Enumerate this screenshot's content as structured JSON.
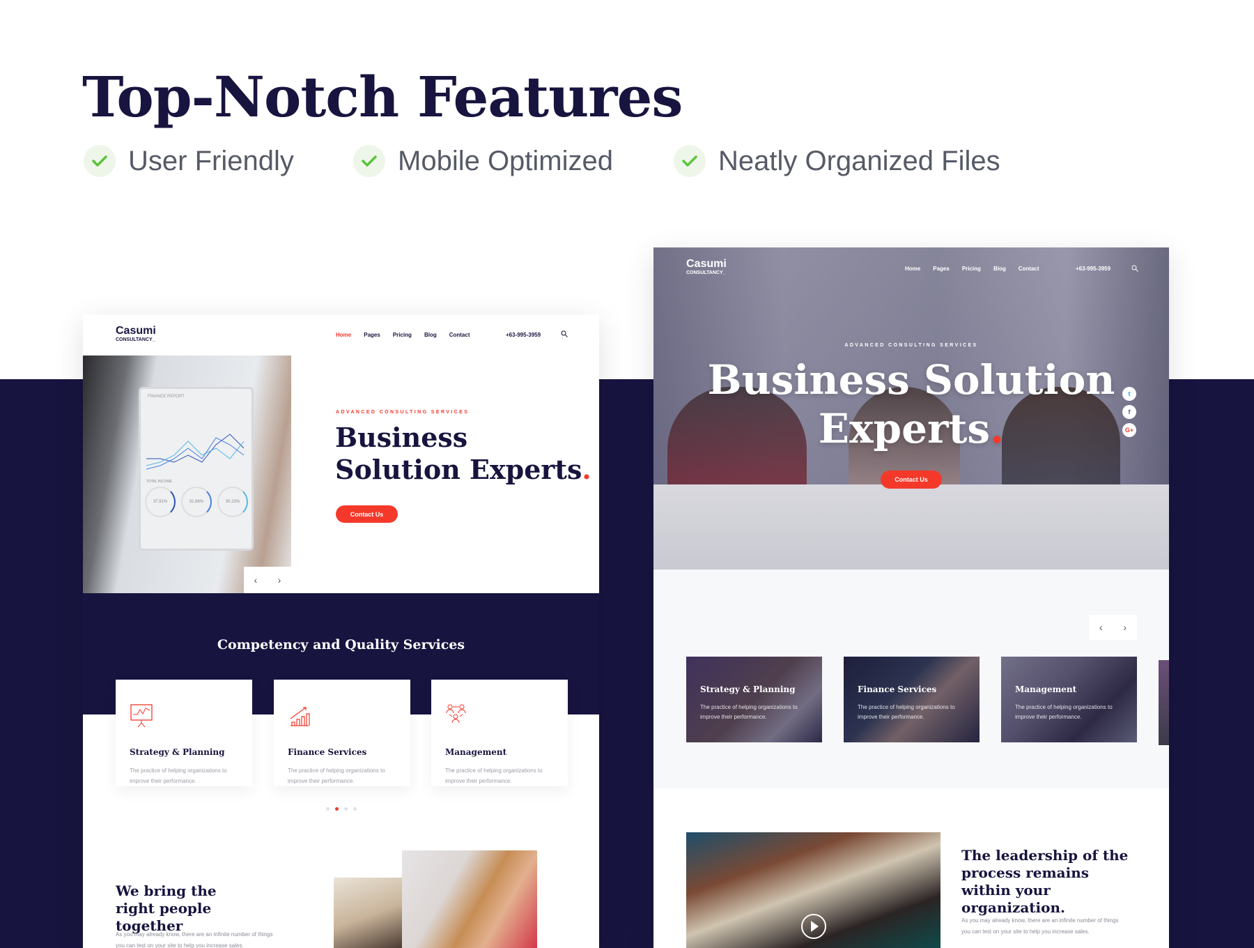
{
  "heading": "Top-Notch Features",
  "features": [
    {
      "label": "User Friendly",
      "icon": "check-icon"
    },
    {
      "label": "Mobile Optimized",
      "icon": "check-icon"
    },
    {
      "label": "Neatly Organized Files",
      "icon": "check-icon"
    }
  ],
  "colors": {
    "navy": "#17143f",
    "accent": "#f4392b",
    "check": "#5ac43a"
  },
  "site": {
    "logo": "Casumi",
    "logo_sub": "CONSULTANCY_",
    "nav": [
      "Home",
      "Pages",
      "Pricing",
      "Blog",
      "Contact"
    ],
    "phone": "+63-995-3959",
    "hero_label": "ADVANCED CONSULTING SERVICES",
    "hero_line1": "Business",
    "hero_line2": "Solution Experts",
    "hero_wide_line1": "Business Solution",
    "hero_wide_line2": "Experts",
    "hero_dot": ".",
    "cta": "Contact Us",
    "tablet": {
      "title": "FINANCE REPORT",
      "total": "TOTAL INCOME",
      "stats": [
        "37.91%",
        "31.86%",
        "30.23%"
      ]
    },
    "services_title": "Competency and Quality Services",
    "services": [
      {
        "title": "Strategy & Planning",
        "text": "The practice of helping organizations to improve their performance.",
        "icon": "presentation-chart-icon"
      },
      {
        "title": "Finance Services",
        "text": "The practice of helping organizations to improve their performance.",
        "icon": "growth-bars-icon"
      },
      {
        "title": "Management",
        "text": "The practice of helping organizations to improve their performance.",
        "icon": "team-icon"
      }
    ],
    "people_title": "We bring the right people together",
    "people_text": "As you may already know, there are an infinite number of things you can test on your site to help you increase sales.",
    "leader_title": "The leadership of the process remains within your organization.",
    "leader_text": "As you may already know, there are an infinite number of things you can test on your site to help you increase sales.",
    "social": [
      "twitter",
      "facebook",
      "google-plus"
    ],
    "slider_active": 2,
    "slider_total": 4
  }
}
